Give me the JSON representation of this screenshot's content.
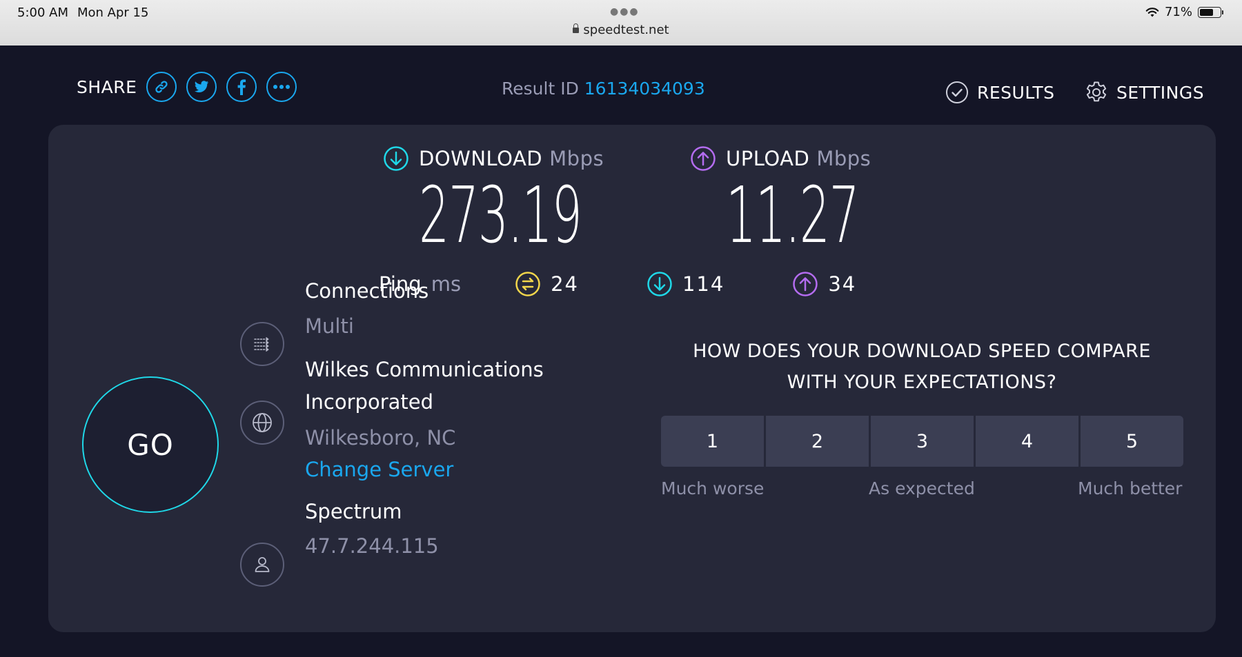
{
  "status_bar": {
    "time": "5:00 AM",
    "date": "Mon Apr 15",
    "url": "speedtest.net",
    "battery": "71%",
    "battery_level": 0.71
  },
  "header": {
    "share_label": "SHARE",
    "share_buttons": [
      "link-icon",
      "twitter-icon",
      "facebook-icon",
      "more-icon"
    ],
    "result_label": "Result ID",
    "result_id": "16134034093",
    "results_label": "RESULTS",
    "settings_label": "SETTINGS"
  },
  "download": {
    "label": "DOWNLOAD",
    "unit": "Mbps",
    "value": "273.19",
    "color": "#1fd8e8"
  },
  "upload": {
    "label": "UPLOAD",
    "unit": "Mbps",
    "value": "11.27",
    "color": "#b46cf0"
  },
  "ping": {
    "label": "Ping",
    "unit": "ms",
    "idle": "24",
    "download": "114",
    "upload": "34",
    "idle_color": "#f2d64b"
  },
  "go_label": "GO",
  "connections": {
    "title": "Connections",
    "value": "Multi"
  },
  "server": {
    "name_line1": "Wilkes Communications",
    "name_line2": "Incorporated",
    "location": "Wilkesboro, NC",
    "change_label": "Change Server"
  },
  "provider": {
    "name": "Spectrum",
    "ip": "47.7.244.115"
  },
  "survey": {
    "question_line1": "HOW DOES YOUR DOWNLOAD SPEED COMPARE",
    "question_line2": "WITH YOUR EXPECTATIONS?",
    "options": [
      "1",
      "2",
      "3",
      "4",
      "5"
    ],
    "low_label": "Much worse",
    "mid_label": "As expected",
    "high_label": "Much better"
  },
  "colors": {
    "accent": "#1aa7ee",
    "background": "#141526",
    "card": "#262839"
  }
}
